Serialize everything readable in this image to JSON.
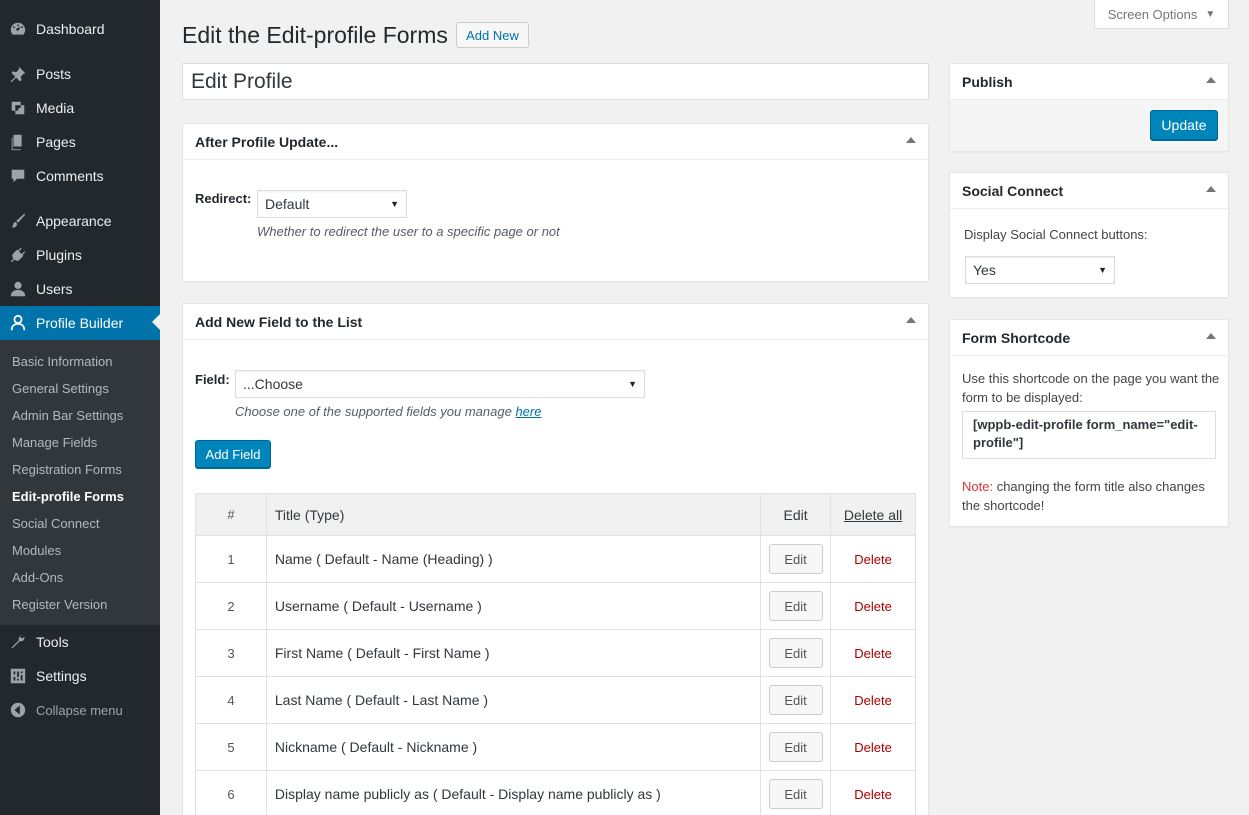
{
  "sidebar": {
    "items": [
      {
        "label": "Dashboard",
        "icon": "dashboard-icon"
      },
      {
        "label": "Posts",
        "icon": "pin-icon"
      },
      {
        "label": "Media",
        "icon": "media-icon"
      },
      {
        "label": "Pages",
        "icon": "pages-icon"
      },
      {
        "label": "Comments",
        "icon": "comment-icon"
      },
      {
        "label": "Appearance",
        "icon": "brush-icon"
      },
      {
        "label": "Plugins",
        "icon": "plugin-icon"
      },
      {
        "label": "Users",
        "icon": "users-icon"
      },
      {
        "label": "Profile Builder",
        "icon": "profile-icon"
      },
      {
        "label": "Tools",
        "icon": "wrench-icon"
      },
      {
        "label": "Settings",
        "icon": "settings-icon"
      },
      {
        "label": "Collapse menu",
        "icon": "collapse-icon"
      }
    ],
    "submenu": [
      "Basic Information",
      "General Settings",
      "Admin Bar Settings",
      "Manage Fields",
      "Registration Forms",
      "Edit-profile Forms",
      "Social Connect",
      "Modules",
      "Add-Ons",
      "Register Version"
    ]
  },
  "header": {
    "title": "Edit the Edit-profile Forms",
    "add_new": "Add New",
    "screen_options": "Screen Options"
  },
  "form_title_value": "Edit Profile",
  "after_update": {
    "title": "After Profile Update...",
    "redirect_label": "Redirect:",
    "redirect_value": "Default",
    "redirect_hint": "Whether to redirect the user to a specific page or not"
  },
  "add_field": {
    "title": "Add New Field to the List",
    "field_label": "Field:",
    "field_value": "...Choose",
    "hint": "Choose one of the supported fields you manage",
    "hint_link": "here",
    "button": "Add Field"
  },
  "table": {
    "headers": {
      "num": "#",
      "title": "Title (Type)",
      "edit": "Edit",
      "delete_all": "Delete all"
    },
    "edit_label": "Edit",
    "delete_label": "Delete",
    "rows": [
      {
        "num": "1",
        "title": "Name ( Default - Name (Heading) )"
      },
      {
        "num": "2",
        "title": "Username ( Default - Username )"
      },
      {
        "num": "3",
        "title": "First Name ( Default - First Name )"
      },
      {
        "num": "4",
        "title": "Last Name ( Default - Last Name )"
      },
      {
        "num": "5",
        "title": "Nickname ( Default - Nickname )"
      },
      {
        "num": "6",
        "title": "Display name publicly as ( Default - Display name publicly as )"
      }
    ]
  },
  "publish": {
    "title": "Publish",
    "update": "Update"
  },
  "social": {
    "title": "Social Connect",
    "label": "Display Social Connect buttons:",
    "value": "Yes"
  },
  "shortcode": {
    "title": "Form Shortcode",
    "intro": "Use this shortcode on the page you want the form to be displayed:",
    "code": "[wppb-edit-profile form_name=\"edit-profile\"]",
    "note_label": "Note:",
    "note_text": " changing the form title also changes the shortcode!"
  },
  "colors": {
    "sidebar_bg": "#23282d",
    "submenu_bg": "#32373c",
    "accent": "#0073aa",
    "primary_button": "#0085ba",
    "delete": "#aa0000"
  }
}
